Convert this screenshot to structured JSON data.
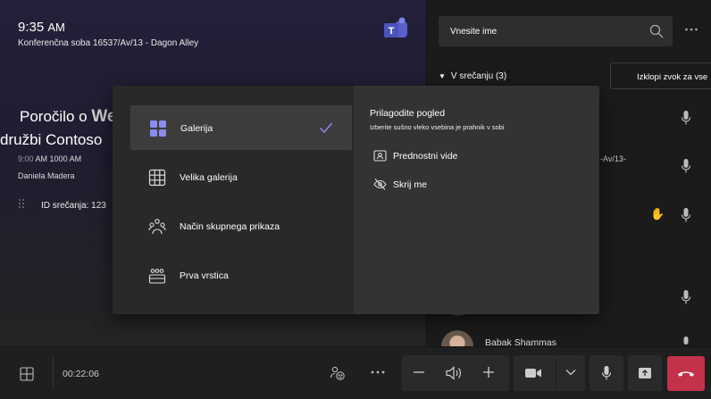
{
  "room": {
    "time": "9:35",
    "ampm": "AM",
    "name": "Konferenčna soba 16537/Av/13 - Dagon Alley"
  },
  "meeting": {
    "title_line1": "Poročilo o",
    "title_line1_cut": "We",
    "title_line2": "družbi Contoso",
    "time_start": "9:00",
    "time_rest": "AM 1000 AM",
    "organizer": "Daniela Madera",
    "id_label": "ID srečanja: 123"
  },
  "roster": {
    "search_placeholder": "Vnesite ime",
    "section_label": "V srečanju (3)",
    "mute_all_label": "Izklopi zvok za vse",
    "fragment": "-Av/13-",
    "participant_name": "Babak Shammas"
  },
  "layout_menu": {
    "options": [
      {
        "label": "Galerija",
        "icon": "gallery-icon",
        "selected": true
      },
      {
        "label": "Velika galerija",
        "icon": "large-gallery-icon",
        "selected": false
      },
      {
        "label": "Način skupnega prikaza",
        "icon": "together-mode-icon",
        "selected": false
      },
      {
        "label": "Prva vrstica",
        "icon": "front-row-icon",
        "selected": false
      }
    ],
    "customize_title": "Prilagodite pogled",
    "customize_subtitle": "Izberite sušno vleko vsebina je prahnik v sobi",
    "customize_items": [
      {
        "label": "Prednostni vide",
        "icon": "content-icon"
      },
      {
        "label": "Skrij me",
        "icon": "eye-off-icon"
      }
    ]
  },
  "toolbar": {
    "timer": "00:22:06"
  },
  "colors": {
    "accent": "#8b8cf0",
    "hangup": "#c4314b",
    "hand": "#e0a232"
  }
}
